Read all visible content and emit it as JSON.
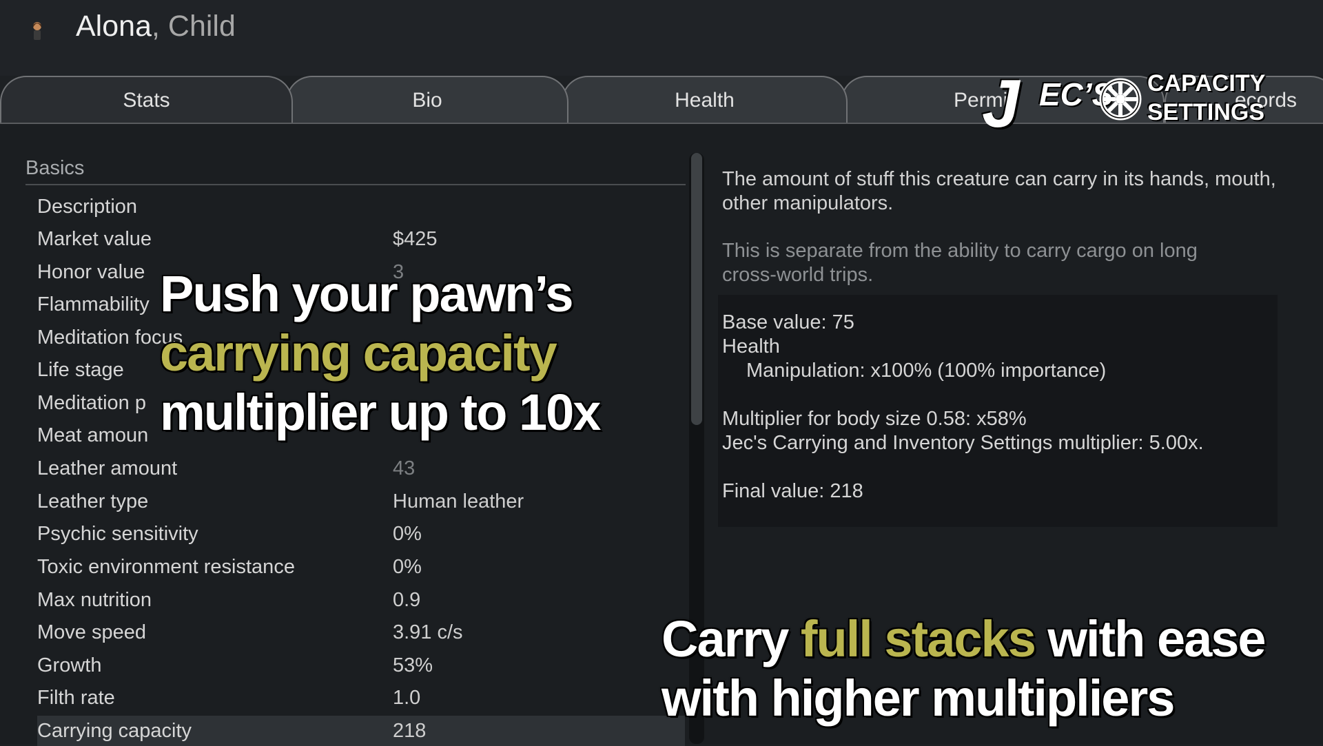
{
  "header": {
    "pawn_name": "Alona",
    "separator": ",",
    "pawn_role": "Child"
  },
  "tabs": [
    {
      "label": "Stats"
    },
    {
      "label": "Bio"
    },
    {
      "label": "Health"
    },
    {
      "label": "Permi"
    },
    {
      "label": "ecords"
    }
  ],
  "stats": {
    "section": "Basics",
    "rows": [
      {
        "label": "Description",
        "value": ""
      },
      {
        "label": "Market value",
        "value": "$425"
      },
      {
        "label": "Honor value",
        "value": "3"
      },
      {
        "label": "Flammability",
        "value": ""
      },
      {
        "label": "Meditation focus",
        "value": ""
      },
      {
        "label": "Life stage",
        "value": ""
      },
      {
        "label": "Meditation p",
        "value": ""
      },
      {
        "label": "Meat amoun",
        "value": ""
      },
      {
        "label": "Leather amount",
        "value": "43"
      },
      {
        "label": "Leather type",
        "value": "Human leather"
      },
      {
        "label": "Psychic sensitivity",
        "value": "0%"
      },
      {
        "label": "Toxic environment resistance",
        "value": "0%"
      },
      {
        "label": "Max nutrition",
        "value": "0.9"
      },
      {
        "label": "Move speed",
        "value": "3.91 c/s"
      },
      {
        "label": "Growth",
        "value": "53%"
      },
      {
        "label": "Filth rate",
        "value": "1.0"
      },
      {
        "label": "Carrying capacity",
        "value": "218"
      }
    ]
  },
  "description": {
    "p1_line1": "The amount of stuff this creature can carry in its hands, mouth,",
    "p1_line2": "other manipulators.",
    "p2_line1": "This is separate from the ability to carry cargo on long",
    "p2_line2": "cross-world trips."
  },
  "explanation": {
    "base": "Base value: 75",
    "health": "Health",
    "manipulation": "Manipulation: x100% (100% importance)",
    "body_size": "Multiplier for body size 0.58: x58%",
    "mod_multiplier": "Jec's Carrying and Inventory Settings multiplier: 5.00x.",
    "final": "Final value: 218"
  },
  "promo": {
    "left_line1": "Push your pawn’s",
    "left_line2": "carrying capacity",
    "left_line3": "multiplier up to 10x",
    "right_line1_a": "Carry ",
    "right_line1_b": "full stacks",
    "right_line1_c": " with ease",
    "right_line2": "with higher multipliers"
  },
  "logo": {
    "j": "J",
    "ecs": "EC’S",
    "line1": "CAPACITY",
    "line2": "SETTINGS"
  },
  "colors": {
    "highlight": "#bab54f",
    "background": "#1b1e21"
  }
}
